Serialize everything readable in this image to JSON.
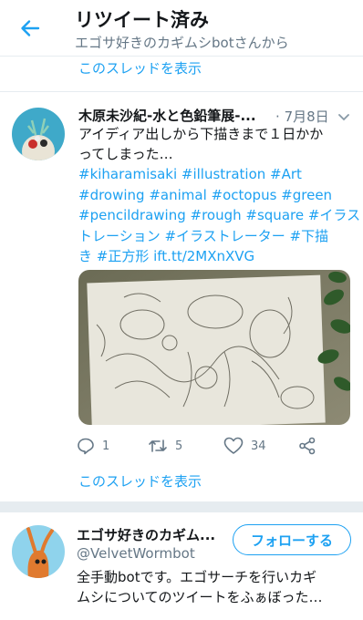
{
  "header": {
    "back_icon": "arrow-left-icon",
    "title": "リツイート済み",
    "subtitle": "エゴサ好きのカギムシbotさんから"
  },
  "thread_link_top": "このスレッドを表示",
  "tweet": {
    "author_name": "木原未沙紀-水と色鉛筆展-...",
    "separator": "·",
    "date": "7月8日",
    "text_lines": [
      "アイディア出しから下描きまで１日かか",
      "ってしまった…"
    ],
    "hashtag_lines": [
      "#kiharamisaki #illustration #Art",
      "#drowing #animal #octopus #green",
      "#pencildrawing #rough #square #イラス",
      "トレーション #イラストレーター #下描",
      "き #正方形 ift.tt/2MXnXVG"
    ],
    "media_icon": "pencil-sketch-image",
    "reply_count": "1",
    "retweet_count": "5",
    "like_count": "34"
  },
  "thread_link_bottom": "このスレッドを表示",
  "user_card": {
    "name": "エゴサ好きのカギム...",
    "handle": "@VelvetWormbot",
    "follow_label": "フォローする",
    "bio_lines": [
      "全手動botです。エゴサーチを行いカギ",
      "ムシについてのツイートをふぁぼった…"
    ]
  },
  "colors": {
    "accent": "#1da1f2",
    "text": "#14171a",
    "muted": "#657786",
    "divider": "#e6ecf0"
  }
}
